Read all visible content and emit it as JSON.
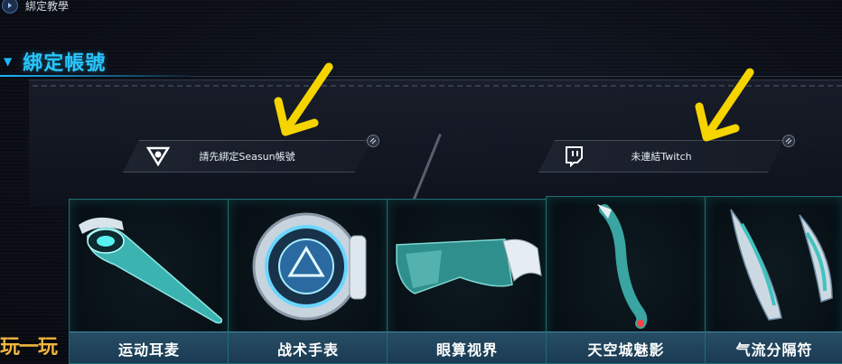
{
  "breadcrumb": {
    "text": "綁定教學",
    "icon": "chevron-right-icon"
  },
  "section": {
    "title": "綁定帳號",
    "caret_icon": "caret-down-icon"
  },
  "bind_slots": {
    "seasun": {
      "label": "請先綁定Seasun帳號",
      "icon": "seasun-logo-icon"
    },
    "twitch": {
      "label": "未連結Twitch",
      "icon": "twitch-logo-icon"
    }
  },
  "items": [
    {
      "label": "运动耳麦",
      "icon": "headset-icon"
    },
    {
      "label": "战术手表",
      "icon": "watch-icon"
    },
    {
      "label": "眼算视界",
      "icon": "visor-icon"
    },
    {
      "label": "天空城魅影",
      "icon": "tail-icon"
    },
    {
      "label": "气流分隔符",
      "icon": "wing-blades-icon"
    }
  ],
  "watermark": {
    "text": "玩一玩"
  },
  "colors": {
    "accent": "#28c6ff",
    "arrow": "#f5d400",
    "card_border": "#1f6e72"
  }
}
